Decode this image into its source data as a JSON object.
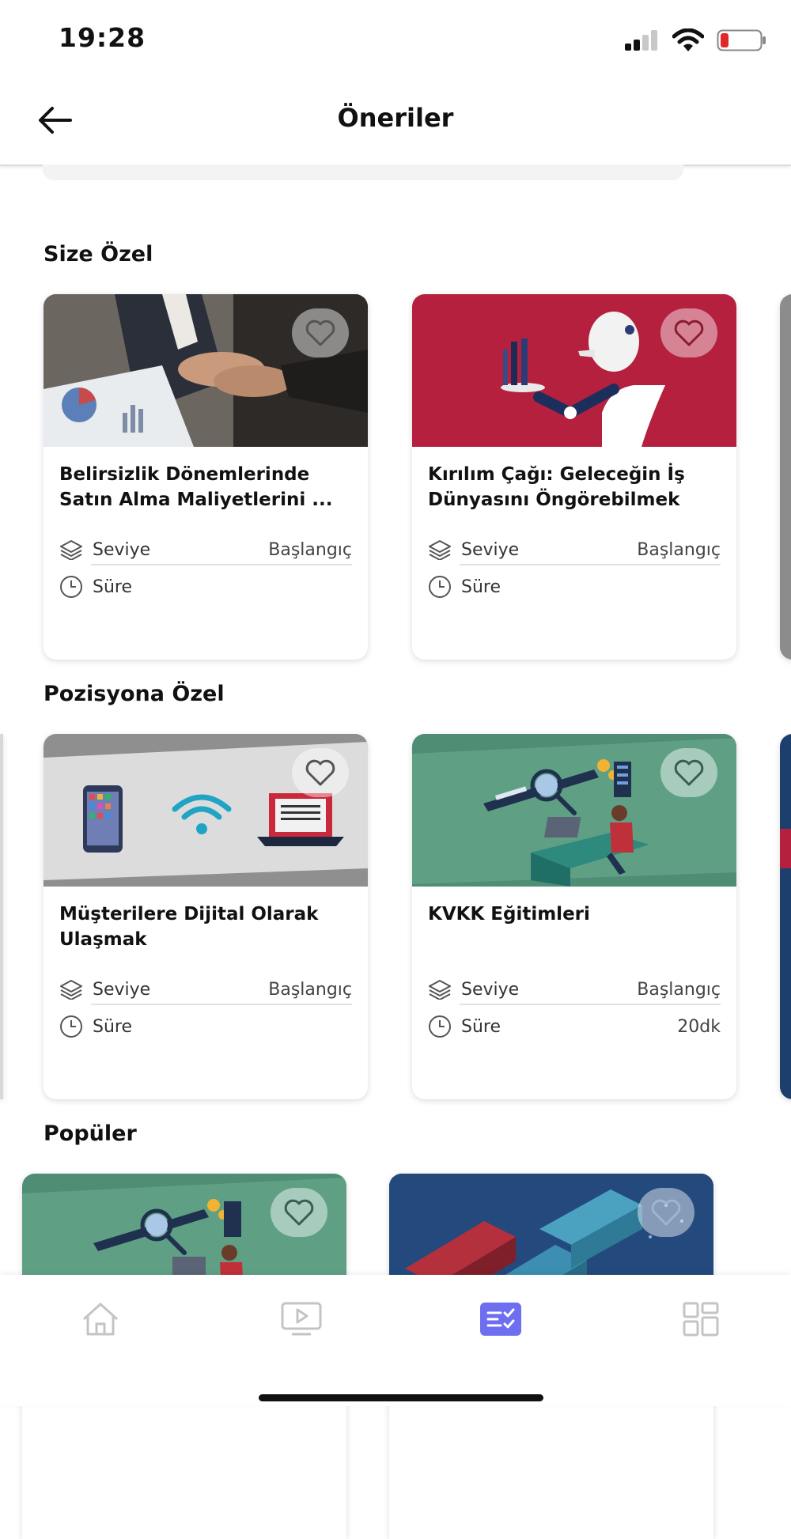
{
  "status_bar": {
    "time": "19:28",
    "icons": [
      "signal-icon",
      "wifi-icon",
      "battery-low-icon"
    ]
  },
  "header": {
    "title": "Öneriler",
    "back_icon": "back-arrow-icon"
  },
  "sections": [
    {
      "title": "Size Özel",
      "cards": [
        {
          "title": "Belirsizlik Dönemlerinde Satın Alma Maliyetlerini ...",
          "level_label": "Seviye",
          "level_value": "Başlangıç",
          "duration_label": "Süre",
          "duration_value": "",
          "image": "handshake-photo"
        },
        {
          "title": "Kırılım Çağı: Geleceğin İş Dünyasını Öngörebilmek",
          "level_label": "Seviye",
          "level_value": "Başlangıç",
          "duration_label": "Süre",
          "duration_value": "",
          "image": "robot-illustration"
        }
      ]
    },
    {
      "title": "Pozisyona Özel",
      "cards": [
        {
          "title": "Müşterilere Dijital Olarak Ulaşmak",
          "level_label": "Seviye",
          "level_value": "Başlangıç",
          "duration_label": "Süre",
          "duration_value": "",
          "image": "devices-wifi-illustration"
        },
        {
          "title": "KVKK Eğitimleri",
          "level_label": "Seviye",
          "level_value": "Başlangıç",
          "duration_label": "Süre",
          "duration_value": "20dk",
          "image": "data-search-illustration"
        }
      ]
    },
    {
      "title": "Popüler",
      "cards": [
        {
          "image": "data-search-illustration"
        },
        {
          "image": "blue-blocks-illustration"
        }
      ]
    }
  ],
  "bottom_nav": [
    {
      "icon": "home-icon",
      "active": false
    },
    {
      "icon": "video-play-icon",
      "active": false
    },
    {
      "icon": "checklist-icon",
      "active": true
    },
    {
      "icon": "dashboard-icon",
      "active": false
    }
  ],
  "colors": {
    "accent": "#6e6ef0",
    "inactive_icon": "#c4c4c4",
    "crimson": "#b5203f",
    "teal": "#55957e",
    "navy": "#1d3f6e"
  }
}
